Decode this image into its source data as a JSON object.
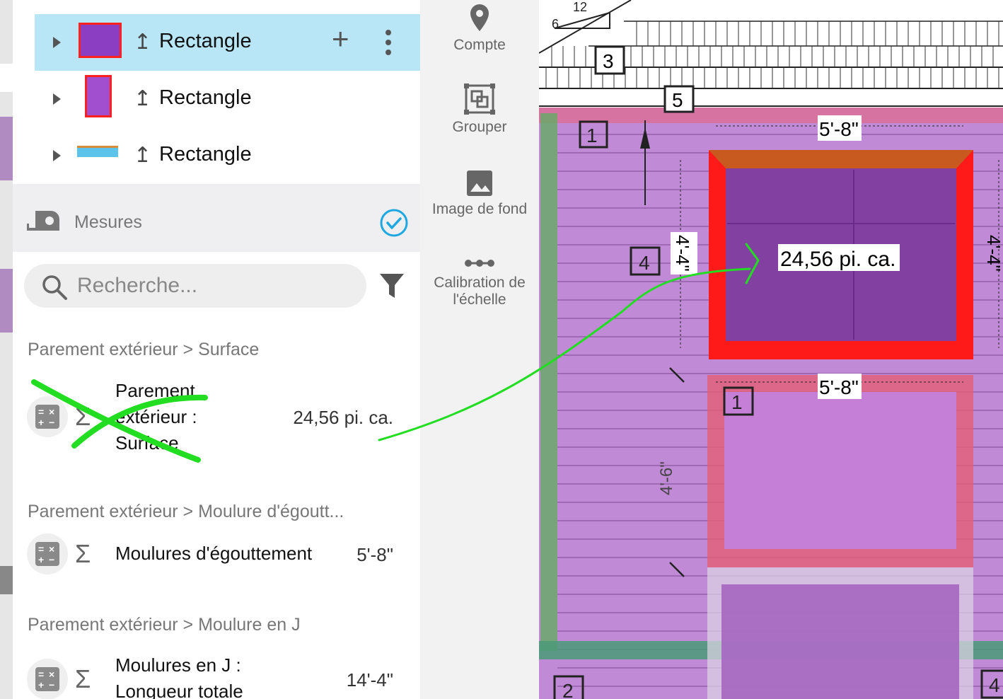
{
  "layers": [
    {
      "label": "Rectangle",
      "selected": true,
      "thumb": "purple-square"
    },
    {
      "label": "Rectangle",
      "selected": false,
      "thumb": "purple-tall"
    },
    {
      "label": "Rectangle",
      "selected": false,
      "thumb": "blue-strip"
    }
  ],
  "mesures": {
    "title": "Mesures",
    "icon": "tape-measure-icon",
    "check_icon": "check-circle-icon"
  },
  "search": {
    "placeholder": "Recherche..."
  },
  "groups": [
    {
      "title": "Parement extérieur > Surface",
      "item": {
        "name_lines": [
          "Parement",
          "extérieur :",
          "Surface"
        ],
        "value": "24,56 pi. ca."
      }
    },
    {
      "title": "Parement extérieur > Moulure d'égoutt...",
      "item": {
        "name_lines": [
          "Moulures d'égouttement"
        ],
        "value": "5'-8\""
      }
    },
    {
      "title": "Parement extérieur > Moulure en J",
      "item": {
        "name_lines": [
          "Moulures en J :",
          "Longueur totale"
        ],
        "value": "14'-4\""
      }
    }
  ],
  "toolbar": [
    {
      "label": "Compte",
      "icon": "map-pin-icon"
    },
    {
      "label": "Grouper",
      "icon": "group-icon"
    },
    {
      "label": "Image de fond",
      "icon": "image-icon"
    },
    {
      "label_lines": [
        "Calibration de",
        "l'échelle"
      ],
      "icon": "calibration-icon"
    }
  ],
  "drawing": {
    "area_label": "24,56 pi. ca.",
    "dim_top": "5'-8\"",
    "dim_bottom": "5'-8\"",
    "dim_left": "4'-4\"",
    "dim_right": "4'-4\"",
    "dim_lower": "4'-6\"",
    "tags": [
      "1",
      "3",
      "4",
      "5",
      "1",
      "2",
      "4"
    ],
    "slope": [
      "6",
      "12"
    ]
  },
  "colors": {
    "selected_row": "#b9e6f7",
    "accent_check": "#1ea7e1",
    "siding": "#c08ad6",
    "window_red": "#ff1a1a",
    "annotation_green": "#22dd22"
  }
}
